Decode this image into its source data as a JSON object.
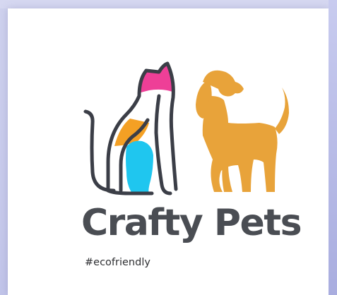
{
  "logo": {
    "brand_name": "Crafty Pets",
    "tagline": "#ecofriendly",
    "colors": {
      "outline": "#3b3e47",
      "cat_ear_pink": "#ee3f97",
      "cat_orange": "#f4a024",
      "cat_blue": "#1fc6ef",
      "dog": "#e8a33a",
      "text": "#4a4d53"
    },
    "icons": [
      "cat-outline-icon",
      "dog-silhouette-icon"
    ]
  }
}
